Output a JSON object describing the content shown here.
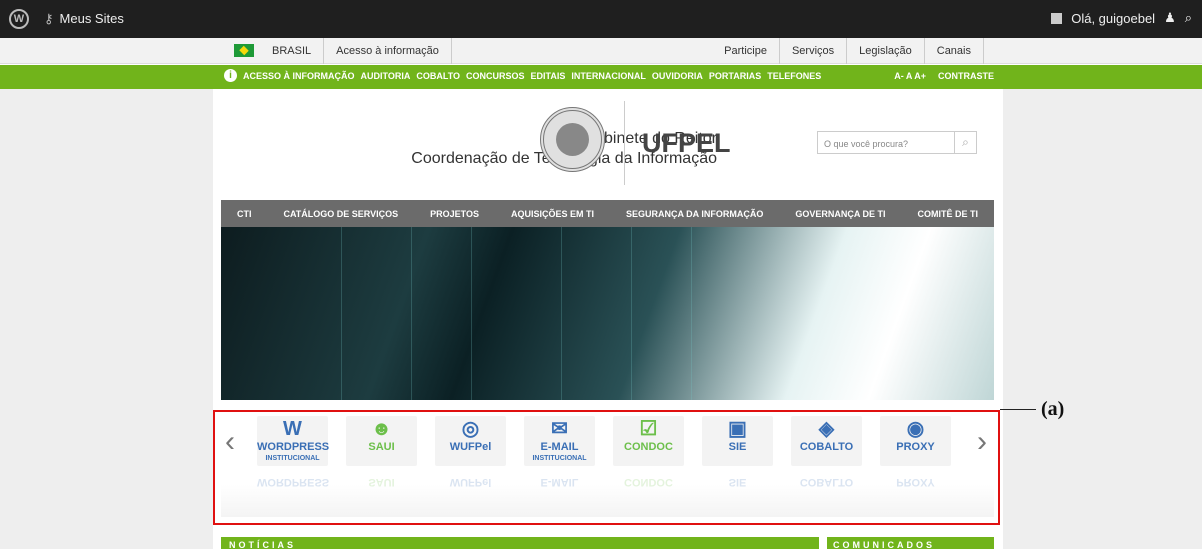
{
  "adminbar": {
    "wp_icon": "wordpress-icon",
    "my_sites": "Meus Sites",
    "greeting": "Olá, guigoebel"
  },
  "govbar": {
    "country": "BRASIL",
    "access": "Acesso à informação",
    "links": [
      "Participe",
      "Serviços",
      "Legislação",
      "Canais"
    ]
  },
  "greenbar": {
    "links": [
      "ACESSO À INFORMAÇÃO",
      "AUDITORIA",
      "COBALTO",
      "CONCURSOS",
      "EDITAIS",
      "INTERNACIONAL",
      "OUVIDORIA",
      "PORTARIAS",
      "TELEFONES"
    ],
    "font_controls": "A- A A+",
    "contrast": "CONTRASTE"
  },
  "header": {
    "line1": "Gabinete do Reitor",
    "line2": "Coordenação de Tecnologia da Informação",
    "brand": "UFPEL",
    "search_placeholder": "O que você procura?"
  },
  "mainnav": [
    "CTI",
    "CATÁLOGO DE SERVIÇOS",
    "PROJETOS",
    "AQUISIÇÕES EM TI",
    "SEGURANÇA DA INFORMAÇÃO",
    "GOVERNANÇA DE TI",
    "COMITÊ DE TI"
  ],
  "services": [
    {
      "label": "WORDPRESS",
      "sub": "INSTITUCIONAL",
      "icon": "W",
      "color": "#3a6fb5"
    },
    {
      "label": "SAUI",
      "sub": "",
      "icon": "☻",
      "color": "#6cbf4a"
    },
    {
      "label": "WUFPel",
      "sub": "",
      "icon": "◎",
      "color": "#3a6fb5"
    },
    {
      "label": "E-MAIL",
      "sub": "INSTITUCIONAL",
      "icon": "✉",
      "color": "#3a6fb5"
    },
    {
      "label": "CONDOC",
      "sub": "",
      "icon": "☑",
      "color": "#6cbf4a"
    },
    {
      "label": "SIE",
      "sub": "",
      "icon": "▣",
      "color": "#3a6fb5"
    },
    {
      "label": "COBALTO",
      "sub": "",
      "icon": "◈",
      "color": "#3a6fb5"
    },
    {
      "label": "PROXY",
      "sub": "",
      "icon": "◉",
      "color": "#3a6fb5"
    }
  ],
  "annotation": "(a)",
  "bottom": {
    "left": "NOTÍCIAS",
    "right": "COMUNICADOS"
  }
}
